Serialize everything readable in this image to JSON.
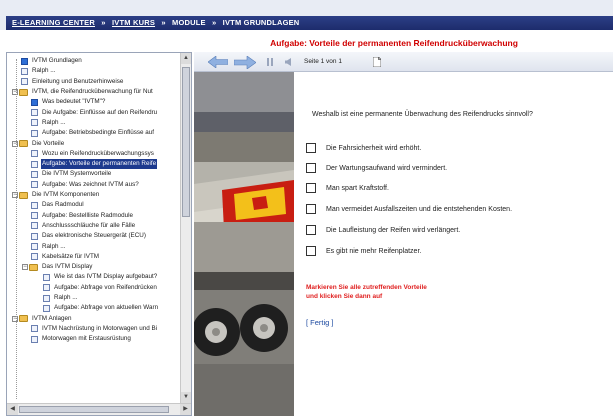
{
  "header": {
    "breadcrumb": [
      {
        "label": "E-LEARNING CENTER",
        "link": true
      },
      {
        "label": "IVTM KURS",
        "link": true
      },
      {
        "label": "MODULE",
        "link": false
      },
      {
        "label": "IVTM GRUNDLAGEN",
        "link": false
      }
    ],
    "separator": "»"
  },
  "task_title": "Aufgabe: Vorteile der permanenten Reifendrucküberwachung",
  "nav": {
    "back_icon": "arrow-left-icon",
    "forward_icon": "arrow-right-icon",
    "pause_icon": "pause-icon",
    "prev_icon": "speaker-icon",
    "page_indicator": "Seite 1 von 1",
    "doc_icon": "document-icon"
  },
  "tree": [
    {
      "label": "IVTM Grundlagen",
      "type": "check",
      "level": 0
    },
    {
      "label": "Ralph ...",
      "type": "doc",
      "level": 0
    },
    {
      "label": "Einleitung und Benutzerhinweise",
      "type": "doc",
      "level": 0
    },
    {
      "label": "IVTM, die Reifendrucküberwachung für Nut",
      "type": "folder",
      "level": 0,
      "expanded": true
    },
    {
      "label": "Was bedeutet \"IVTM\"?",
      "type": "check",
      "level": 1
    },
    {
      "label": "Die Aufgabe: Einflüsse auf den Reifendru",
      "type": "doc",
      "level": 1
    },
    {
      "label": "Ralph ...",
      "type": "doc",
      "level": 1
    },
    {
      "label": "Aufgabe: Betriebsbedingte Einflüsse auf",
      "type": "doc",
      "level": 1
    },
    {
      "label": "Die Vorteile",
      "type": "folder",
      "level": 0,
      "expanded": true
    },
    {
      "label": "Wozu ein Reifendrucküberwachungssys",
      "type": "doc",
      "level": 1
    },
    {
      "label": "Aufgabe: Vorteile der permanenten Reife",
      "type": "doc",
      "level": 1,
      "selected": true
    },
    {
      "label": "Die IVTM Systemvorteile",
      "type": "doc",
      "level": 1
    },
    {
      "label": "Aufgabe: Was zeichnet IVTM aus?",
      "type": "doc",
      "level": 1
    },
    {
      "label": "Die IVTM Komponenten",
      "type": "folder",
      "level": 0,
      "expanded": true
    },
    {
      "label": "Das Radmodul",
      "type": "doc",
      "level": 1
    },
    {
      "label": "Aufgabe: Bestellliste Radmodule",
      "type": "doc",
      "level": 1
    },
    {
      "label": "Anschlussschläuche für alle Fälle",
      "type": "doc",
      "level": 1
    },
    {
      "label": "Das elektronische Steuergerät (ECU)",
      "type": "doc",
      "level": 1
    },
    {
      "label": "Ralph ...",
      "type": "doc",
      "level": 1
    },
    {
      "label": "Kabelsätze für IVTM",
      "type": "doc",
      "level": 1
    },
    {
      "label": "Das IVTM Display",
      "type": "folder",
      "level": 1,
      "expanded": true
    },
    {
      "label": "Wie ist das IVTM Display aufgebaut?",
      "type": "doc",
      "level": 2
    },
    {
      "label": "Aufgabe: Abfrage von Reifendrücken",
      "type": "doc",
      "level": 2
    },
    {
      "label": "Ralph ...",
      "type": "doc",
      "level": 2
    },
    {
      "label": "Aufgabe: Abfrage von aktuellen Warn",
      "type": "doc",
      "level": 2
    },
    {
      "label": "IVTM Anlagen",
      "type": "folder",
      "level": 0,
      "expanded": true
    },
    {
      "label": "IVTM Nachrüstung in Motorwagen und Bi",
      "type": "doc",
      "level": 1
    },
    {
      "label": "Motorwagen mit Erstausrüstung",
      "type": "doc",
      "level": 1
    }
  ],
  "question": "Weshalb ist eine permanente Überwachung des Reifendrucks sinnvoll?",
  "options": [
    "Die Fahrsicherheit wird erhöht.",
    "Der Wartungsaufwand wird vermindert.",
    "Man spart Kraftstoff.",
    "Man vermeidet Ausfallszeiten und die entstehenden Kosten.",
    "Die Laufleistung der Reifen wird verlängert.",
    "Es gibt nie mehr Reifenplatzer."
  ],
  "instruction_lines": [
    "Markieren Sie alle zutreffenden Vorteile",
    "und klicken Sie dann auf"
  ],
  "submit_label": "[ Fertig ]",
  "colors": {
    "title_bar": "#1d2c6c",
    "accent_red": "#d00000",
    "selected_bg": "#1d3a8e",
    "nav_arrow": "#8fb0e0"
  }
}
